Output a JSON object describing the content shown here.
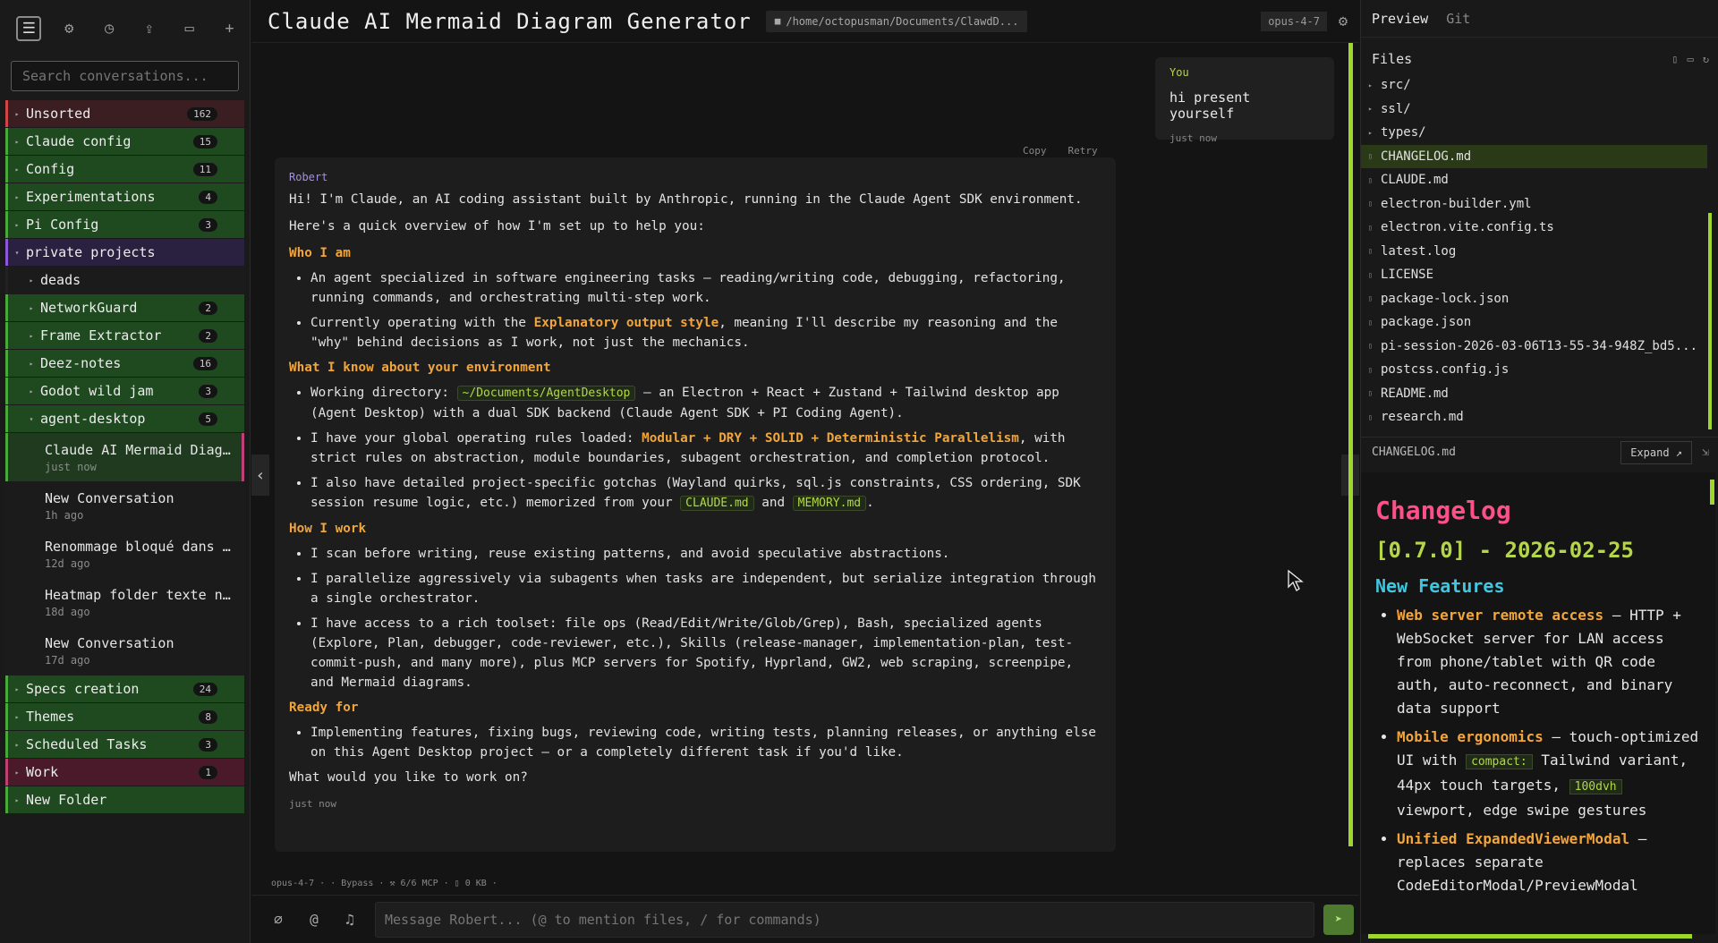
{
  "toolbar": {
    "icons": [
      "sidebar-icon",
      "gear-icon",
      "history-icon",
      "upload-icon",
      "folder-icon",
      "plus-icon"
    ]
  },
  "search": {
    "placeholder": "Search conversations..."
  },
  "folders": [
    {
      "name": "Unsorted",
      "count": "162",
      "color": "red"
    },
    {
      "name": "Claude config",
      "count": "15",
      "color": "green"
    },
    {
      "name": "Config",
      "count": "11",
      "color": "green"
    },
    {
      "name": "Experimentations",
      "count": "4",
      "color": "green"
    },
    {
      "name": "Pi Config",
      "count": "3",
      "color": "green"
    },
    {
      "name": "private projects",
      "count": "",
      "color": "purple"
    },
    {
      "name": "deads",
      "count": "",
      "color": "dark"
    },
    {
      "name": "NetworkGuard",
      "count": "2",
      "color": "green"
    },
    {
      "name": "Frame Extractor",
      "count": "2",
      "color": "green"
    },
    {
      "name": "Deez-notes",
      "count": "16",
      "color": "green"
    },
    {
      "name": "Godot wild jam",
      "count": "3",
      "color": "green"
    },
    {
      "name": "agent-desktop",
      "count": "5",
      "color": "green"
    }
  ],
  "conversations": [
    {
      "title": "Claude AI Mermaid Diag...",
      "date": "just now"
    },
    {
      "title": "New Conversation",
      "date": "1h ago"
    },
    {
      "title": "Renommage bloqué dans ...",
      "date": "12d ago"
    },
    {
      "title": "Heatmap folder texte n...",
      "date": "18d ago"
    },
    {
      "title": "New Conversation",
      "date": "17d ago"
    }
  ],
  "folders_bottom": [
    {
      "name": "Specs creation",
      "count": "24",
      "color": "green"
    },
    {
      "name": "Themes",
      "count": "8",
      "color": "green"
    },
    {
      "name": "Scheduled Tasks",
      "count": "3",
      "color": "green"
    },
    {
      "name": "Work",
      "count": "1",
      "color": "pink"
    },
    {
      "name": "New Folder",
      "count": "",
      "color": "green"
    }
  ],
  "header": {
    "title": "Claude AI Mermaid Diagram Generator",
    "path": "/home/octopusman/Documents/ClawdD...",
    "model": "opus-4-7"
  },
  "user_message": {
    "author": "You",
    "text": "hi present yourself",
    "time": "just now"
  },
  "message_actions": {
    "copy": "Copy",
    "retry": "Retry"
  },
  "assistant_message": {
    "author": "Robert",
    "intro": "Hi! I'm Claude, an AI coding assistant built by Anthropic, running in the Claude Agent SDK environment.",
    "overview": "Here's a quick overview of how I'm set up to help you:",
    "h_who": "Who I am",
    "who_1": "An agent specialized in software engineering tasks — reading/writing code, debugging, refactoring, running commands, and orchestrating multi-step work.",
    "who_2_pre": "Currently operating with the ",
    "who_2_hl": "Explanatory output style",
    "who_2_post": ", meaning I'll describe my reasoning and the \"why\" behind decisions as I work, not just the mechanics.",
    "h_env": "What I know about your environment",
    "env_1_pre": "Working directory: ",
    "env_1_code": "~/Documents/AgentDesktop",
    "env_1_post": " — an Electron + React + Zustand + Tailwind desktop app (Agent Desktop) with a dual SDK backend (Claude Agent SDK + PI Coding Agent).",
    "env_2_pre": "I have your global operating rules loaded: ",
    "env_2_hl": "Modular + DRY + SOLID + Deterministic Parallelism",
    "env_2_post": ", with strict rules on abstraction, module boundaries, subagent orchestration, and completion protocol.",
    "env_3_pre": "I also have detailed project-specific gotchas (Wayland quirks, sql.js constraints, CSS ordering, SDK session resume logic, etc.) memorized from your ",
    "env_3_code1": "CLAUDE.md",
    "env_3_mid": " and ",
    "env_3_code2": "MEMORY.md",
    "env_3_post": ".",
    "h_work": "How I work",
    "work_1": "I scan before writing, reuse existing patterns, and avoid speculative abstractions.",
    "work_2": "I parallelize aggressively via subagents when tasks are independent, but serialize integration through a single orchestrator.",
    "work_3": "I have access to a rich toolset: file ops (Read/Edit/Write/Glob/Grep), Bash, specialized agents (Explore, Plan, debugger, code-reviewer, etc.), Skills (release-manager, implementation-plan, test-commit-push, and many more), plus MCP servers for Spotify, Hyprland, GW2, web scraping, screenpipe, and Mermaid diagrams.",
    "h_ready": "Ready for",
    "ready_1": "Implementing features, fixing bugs, reviewing code, writing tests, planning releases, or anything else on this Agent Desktop project — or a completely different task if you'd like.",
    "closing": "What would you like to work on?",
    "time": "just now"
  },
  "statusline": {
    "model": "opus-4-7 ·",
    "mode": "· Bypass ·",
    "mcp": "6/6 MCP ·",
    "size": "0 KB ·"
  },
  "composer": {
    "placeholder": "Message Robert... (@ to mention files, / for commands)"
  },
  "right_panel": {
    "tabs": [
      "Preview",
      "Git"
    ],
    "files_title": "Files",
    "files": [
      {
        "name": "src/",
        "type": "dir"
      },
      {
        "name": "ssl/",
        "type": "dir"
      },
      {
        "name": "types/",
        "type": "dir"
      },
      {
        "name": "CHANGELOG.md",
        "type": "file",
        "selected": true
      },
      {
        "name": "CLAUDE.md",
        "type": "file"
      },
      {
        "name": "electron-builder.yml",
        "type": "file"
      },
      {
        "name": "electron.vite.config.ts",
        "type": "file"
      },
      {
        "name": "latest.log",
        "type": "file"
      },
      {
        "name": "LICENSE",
        "type": "file"
      },
      {
        "name": "package-lock.json",
        "type": "file"
      },
      {
        "name": "package.json",
        "type": "file"
      },
      {
        "name": "pi-session-2026-03-06T13-55-34-948Z_bd5...",
        "type": "file"
      },
      {
        "name": "postcss.config.js",
        "type": "file"
      },
      {
        "name": "README.md",
        "type": "file"
      },
      {
        "name": "research.md",
        "type": "file"
      }
    ],
    "preview_file": "CHANGELOG.md",
    "expand_label": "Expand ↗",
    "preview": {
      "h1": "Changelog",
      "h2": "[0.7.0] - 2026-02-25",
      "h3": "New Features",
      "i1_b": "Web server remote access",
      "i1_t": " — HTTP + WebSocket server for LAN access from phone/tablet with QR code auth, auto-reconnect, and binary data support",
      "i2_b": "Mobile ergonomics",
      "i2_t1": " — touch-optimized UI with ",
      "i2_code1": "compact:",
      "i2_t2": " Tailwind variant, 44px touch targets, ",
      "i2_code2": "100dvh",
      "i2_t3": " viewport, edge swipe gestures",
      "i3_b": "Unified ExpandedViewerModal",
      "i3_t": " — replaces separate CodeEditorModal/PreviewModal"
    }
  },
  "colors": {
    "accent_green": "#9fd62b",
    "heading_orange": "#f2a53a",
    "changelog_pink": "#ff4f88",
    "changelog_cyan": "#3fc6e0"
  }
}
